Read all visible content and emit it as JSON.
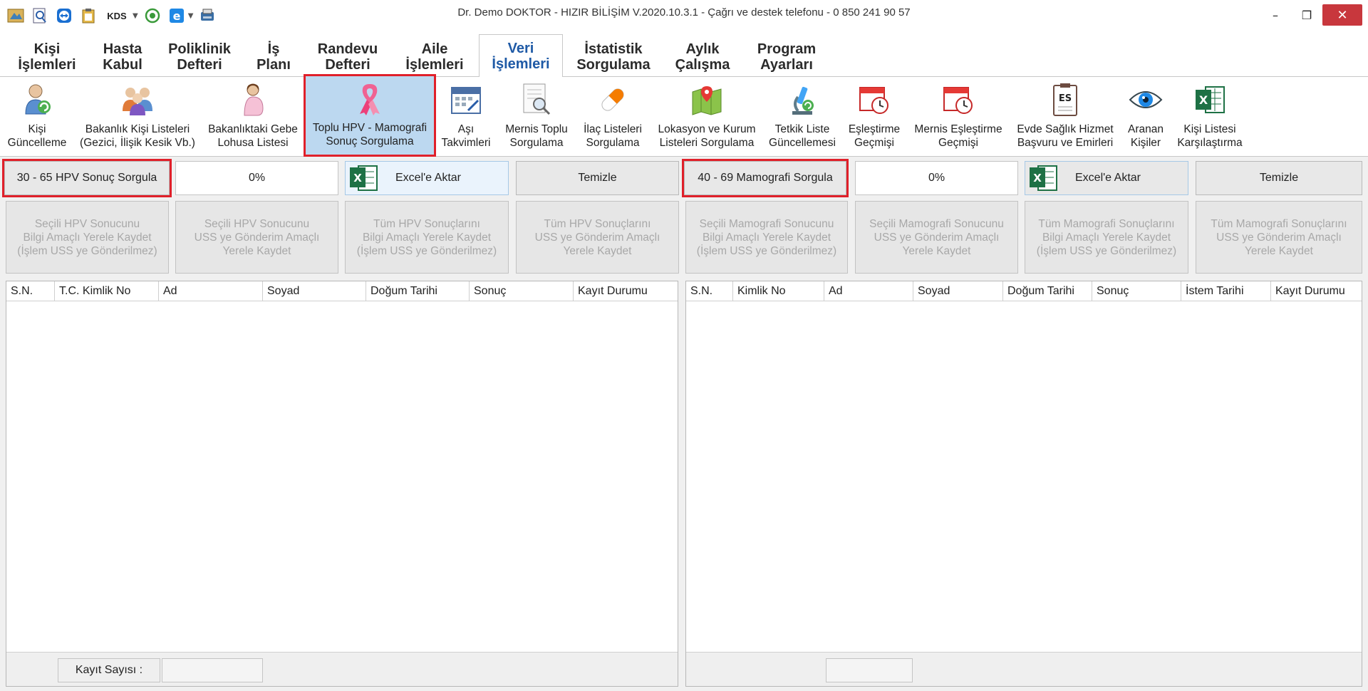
{
  "window": {
    "title": "Dr. Demo DOKTOR - HIZIR BİLİŞİM V.2020.10.3.1 - Çağrı ve destek telefonu - 0 850 241 90 57",
    "kds_label": "KDS",
    "minimize": "–",
    "restore": "❐",
    "close": "✕"
  },
  "tabs": [
    {
      "label": "Kişi\nİşlemleri",
      "active": false
    },
    {
      "label": "Hasta\nKabul",
      "active": false
    },
    {
      "label": "Poliklinik\nDefteri",
      "active": false
    },
    {
      "label": "İş\nPlanı",
      "active": false
    },
    {
      "label": "Randevu\nDefteri",
      "active": false
    },
    {
      "label": "Aile\nİşlemleri",
      "active": false
    },
    {
      "label": "Veri\nİşlemleri",
      "active": true
    },
    {
      "label": "İstatistik\nSorgulama",
      "active": false
    },
    {
      "label": "Aylık\nÇalışma",
      "active": false
    },
    {
      "label": "Program\nAyarları",
      "active": false
    }
  ],
  "ribbon": [
    {
      "label": "Kişi\nGüncelleme",
      "icon": "user-refresh-icon"
    },
    {
      "label": "Bakanlık Kişi Listeleri\n(Gezici, İlişik Kesik Vb.)",
      "icon": "users-group-icon"
    },
    {
      "label": "Bakanlıktaki Gebe\nLohusa Listesi",
      "icon": "pregnant-woman-icon"
    },
    {
      "label": "Toplu HPV - Mamografi\nSonuç Sorgulama",
      "icon": "pink-ribbon-icon",
      "selected": true
    },
    {
      "label": "Aşı\nTakvimleri",
      "icon": "calendar-icon"
    },
    {
      "label": "Mernis Toplu\nSorgulama",
      "icon": "document-search-icon"
    },
    {
      "label": "İlaç Listeleri\nSorgulama",
      "icon": "pill-icon"
    },
    {
      "label": "Lokasyon ve Kurum\nListeleri Sorgulama",
      "icon": "map-icon"
    },
    {
      "label": "Tetkik Liste\nGüncellemesi",
      "icon": "microscope-icon"
    },
    {
      "label": "Eşleştirme\nGeçmişi",
      "icon": "calendar-clock-icon"
    },
    {
      "label": "Mernis Eşleştirme\nGeçmişi",
      "icon": "calendar-clock-icon"
    },
    {
      "label": "Evde Sağlık Hizmet\nBaşvuru ve Emirleri",
      "icon": "es-clipboard-icon"
    },
    {
      "label": "Aranan\nKişiler",
      "icon": "eye-icon"
    },
    {
      "label": "Kişi Listesi\nKarşılaştırma",
      "icon": "excel-icon"
    }
  ],
  "hpv": {
    "query_button": "30 - 65 HPV Sonuç Sorgula",
    "progress": "0%",
    "excel_button": "Excel'e Aktar",
    "clear_button": "Temizle",
    "actions": [
      "Seçili HPV Sonucunu\nBilgi Amaçlı Yerele Kaydet\n(İşlem USS ye Gönderilmez)",
      "Seçili HPV Sonucunu\nUSS ye Gönderim Amaçlı\nYerele Kaydet",
      "Tüm HPV Sonuçlarını\nBilgi Amaçlı Yerele Kaydet\n(İşlem USS ye Gönderilmez)",
      "Tüm HPV Sonuçlarını\nUSS ye Gönderim Amaçlı\nYerele Kaydet"
    ],
    "columns": [
      "S.N.",
      "T.C. Kimlik No",
      "Ad",
      "Soyad",
      "Doğum Tarihi",
      "Sonuç",
      "Kayıt Durumu"
    ],
    "footer_label": "Kayıt Sayısı :",
    "footer_value": ""
  },
  "mamo": {
    "query_button": "40 - 69 Mamografi Sorgula",
    "progress": "0%",
    "excel_button": "Excel'e Aktar",
    "clear_button": "Temizle",
    "actions": [
      "Seçili Mamografi Sonucunu\nBilgi Amaçlı Yerele Kaydet\n(İşlem USS ye Gönderilmez)",
      "Seçili Mamografi Sonucunu\nUSS ye Gönderim Amaçlı\nYerele Kaydet",
      "Tüm Mamografi Sonuçlarını\nBilgi Amaçlı Yerele Kaydet\n(İşlem USS ye Gönderilmez)",
      "Tüm Mamografi Sonuçlarını\nUSS ye Gönderim Amaçlı\nYerele Kaydet"
    ],
    "columns": [
      "S.N.",
      "Kimlik No",
      "Ad",
      "Soyad",
      "Doğum Tarihi",
      "Sonuç",
      "İstem Tarihi",
      "Kayıt Durumu"
    ],
    "footer_value": ""
  },
  "colors": {
    "accent": "#1f5aa6",
    "highlight_border": "#e0202a",
    "selected_bg": "#bcd8f0"
  }
}
